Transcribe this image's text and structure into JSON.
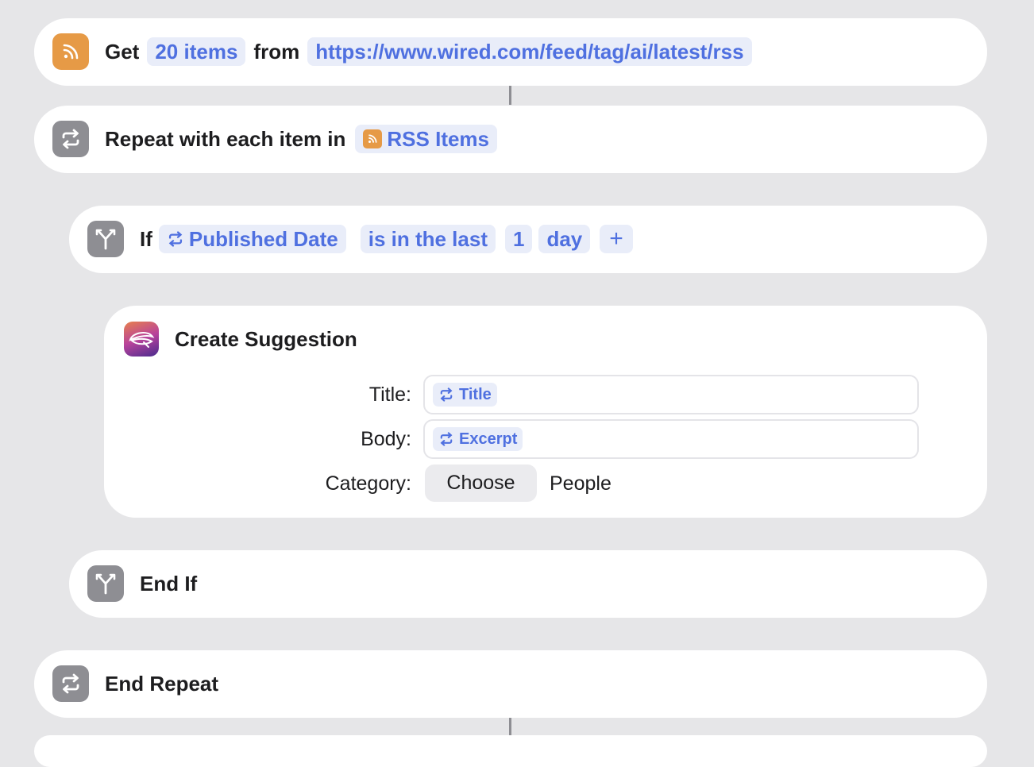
{
  "get_rss": {
    "label_get": "Get",
    "count": "20 items",
    "label_from": "from",
    "url": "https://www.wired.com/feed/tag/ai/latest/rss",
    "icon": "rss-icon"
  },
  "repeat": {
    "label": "Repeat with each item in",
    "variable": "RSS Items",
    "icon": "repeat-icon"
  },
  "if_block": {
    "label": "If",
    "variable": "Published Date",
    "condition": "is in the last",
    "amount": "1",
    "unit": "day",
    "add": "+",
    "icon": "branch-icon"
  },
  "create_suggestion": {
    "title": "Create Suggestion",
    "fields": {
      "title_label": "Title:",
      "title_value": "Title",
      "body_label": "Body:",
      "body_value": "Excerpt",
      "category_label": "Category:",
      "choose": "Choose",
      "category_value": "People"
    }
  },
  "end_if": {
    "label": "End If"
  },
  "end_repeat": {
    "label": "End Repeat"
  },
  "colors": {
    "background": "#e6e6e8",
    "card": "#ffffff",
    "accent": "#4f70e0",
    "pill_bg": "#e9edf9",
    "rss_orange": "#e69a46",
    "gray_icon": "#8e8e93"
  }
}
